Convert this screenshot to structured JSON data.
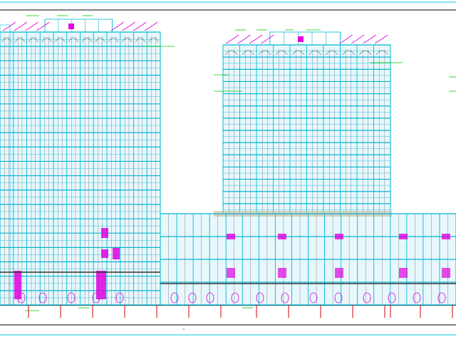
{
  "drawing": {
    "kind": "architectural-elevation",
    "background": "#ffffff",
    "colors": {
      "facade_line": "#00b8d4",
      "facade_line_dark": "#0090b0",
      "mullion": "#7a8a99",
      "window_fill": "#e8f7fb",
      "annotation_leader": "#00cc00",
      "accent": "#e000e0",
      "column_marker": "#cc0000",
      "ground_line": "#000000",
      "podium_wall": "#c8b89a",
      "frame": "#00c8e0"
    },
    "scale_mark": "~",
    "buildings": [
      {
        "name": "tower-left",
        "floors": 19,
        "bays": 12
      },
      {
        "name": "tower-right",
        "floors": 14,
        "bays": 10
      },
      {
        "name": "podium",
        "floors": 4,
        "bays": 18
      }
    ]
  }
}
